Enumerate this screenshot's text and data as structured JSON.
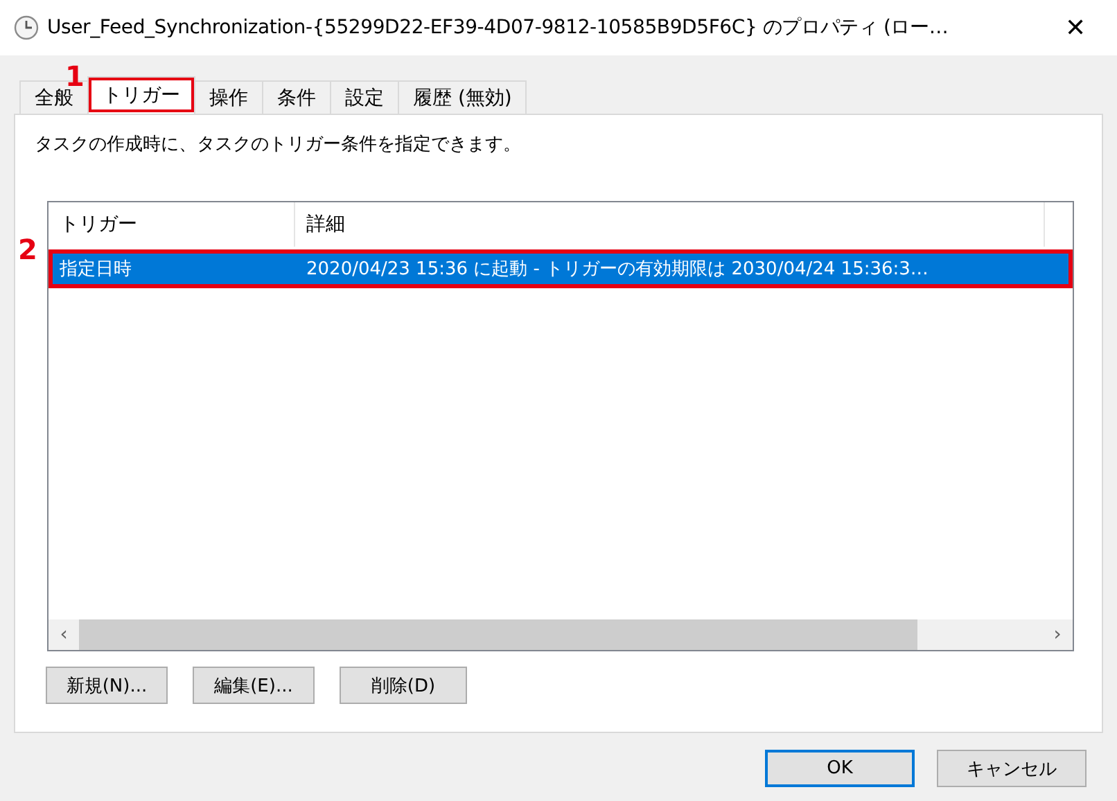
{
  "window": {
    "title": "User_Feed_Synchronization-{55299D22-EF39-4D07-9812-10585B9D5F6C} のプロパティ (ロー…",
    "close": "✕"
  },
  "tabs": [
    {
      "label": "全般",
      "selected": false
    },
    {
      "label": "トリガー",
      "selected": true,
      "annotation": "1"
    },
    {
      "label": "操作",
      "selected": false
    },
    {
      "label": "条件",
      "selected": false
    },
    {
      "label": "設定",
      "selected": false
    },
    {
      "label": "履歴 (無効)",
      "selected": false
    }
  ],
  "description": "タスクの作成時に、タスクのトリガー条件を指定できます。",
  "table": {
    "columns": [
      "トリガー",
      "詳細"
    ],
    "rows": [
      {
        "cells": [
          "指定日時",
          "2020/04/23 15:36 に起動 - トリガーの有効期限は 2030/04/24 15:36:3…"
        ],
        "selected": true,
        "annotation": "2"
      }
    ],
    "scrollbar": {
      "left": "‹",
      "right": "›"
    }
  },
  "actions": [
    "新規(N)...",
    "編集(E)...",
    "削除(D)"
  ],
  "buttons": [
    {
      "label": "OK",
      "default": true
    },
    {
      "label": "キャンセル",
      "default": false
    }
  ]
}
